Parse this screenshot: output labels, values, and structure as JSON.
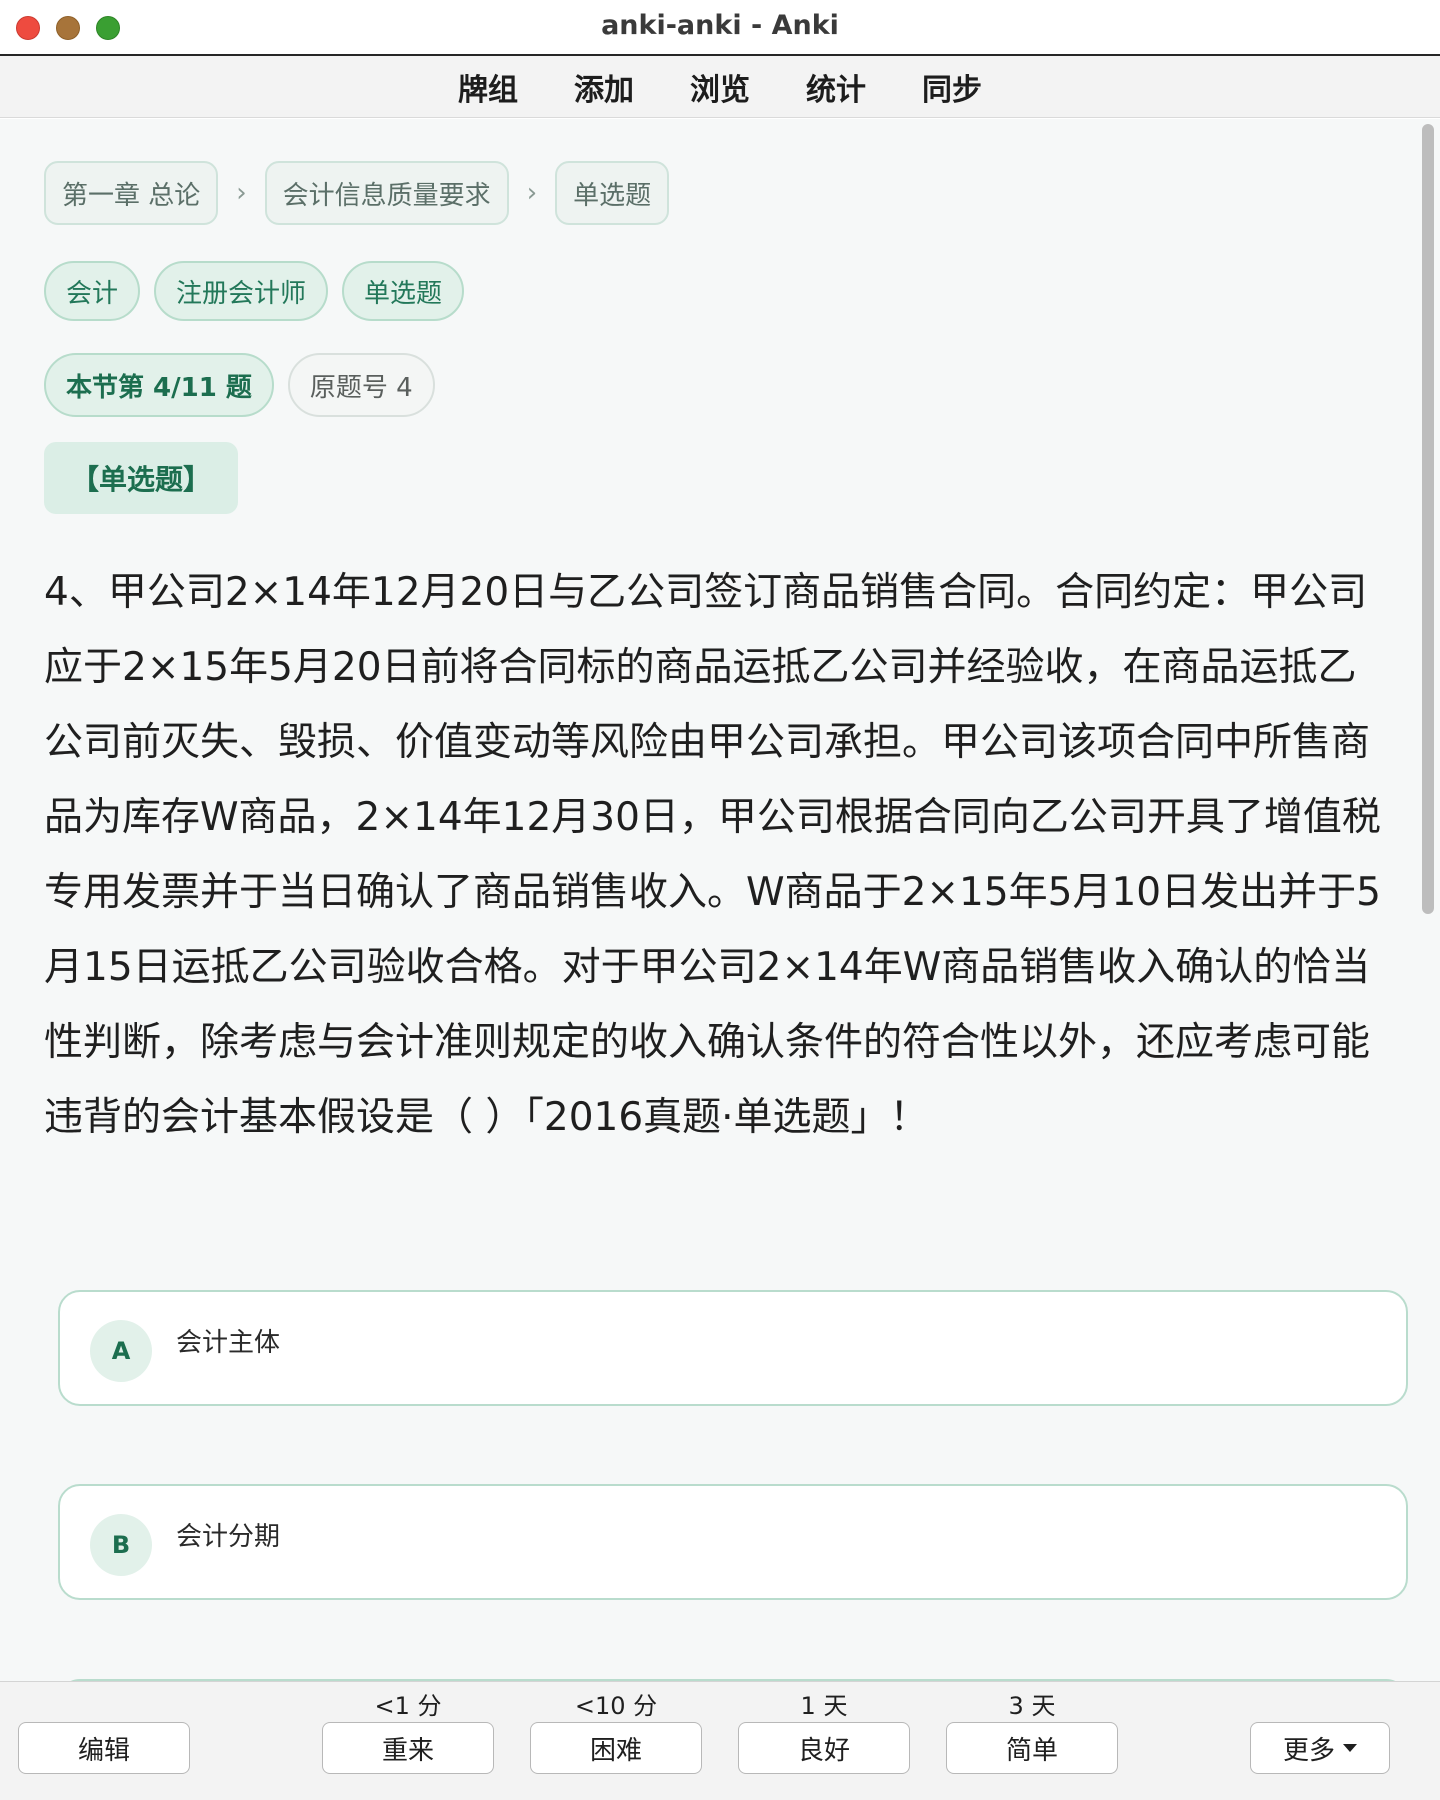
{
  "window": {
    "title": "anki-anki - Anki"
  },
  "toolbar": {
    "items": [
      "牌组",
      "添加",
      "浏览",
      "统计",
      "同步"
    ]
  },
  "breadcrumb": [
    "第一章 总论",
    "会计信息质量要求",
    "单选题"
  ],
  "breadcrumb_sep": "›",
  "tags": [
    "会计",
    "注册会计师",
    "单选题"
  ],
  "meta": {
    "section_progress": "本节第 4/11 题",
    "original_no": "原题号 4"
  },
  "question_type": "【单选题】",
  "question": "4、甲公司2×14年12月20日与乙公司签订商品销售合同。合同约定：甲公司应于2×15年5月20日前将合同标的商品运抵乙公司并经验收，在商品运抵乙公司前灭失、毁损、价值变动等风险由甲公司承担。甲公司该项合同中所售商品为库存W商品，2×14年12月30日，甲公司根据合同向乙公司开具了增值税专用发票并于当日确认了商品销售收入。W商品于2×15年5月10日发出并于5月15日运抵乙公司验收合格。对于甲公司2×14年W商品销售收入确认的恰当性判断，除考虑与会计准则规定的收入确认条件的符合性以外，还应考虑可能违背的会计基本假设是（ ）「2016真题·单选题」！",
  "options": [
    {
      "letter": "A",
      "text": "会计主体"
    },
    {
      "letter": "B",
      "text": "会计分期"
    }
  ],
  "answer_bar": {
    "edit": "编辑",
    "again": {
      "label": "重来",
      "interval": "<1 分"
    },
    "hard": {
      "label": "困难",
      "interval": "<10 分"
    },
    "good": {
      "label": "良好",
      "interval": "1 天"
    },
    "easy": {
      "label": "简单",
      "interval": "3 天"
    },
    "more": "更多"
  },
  "colors": {
    "accent": "#1c6e4f",
    "tag_bg": "#e2f1ea",
    "content_bg": "#f6f8f8"
  }
}
